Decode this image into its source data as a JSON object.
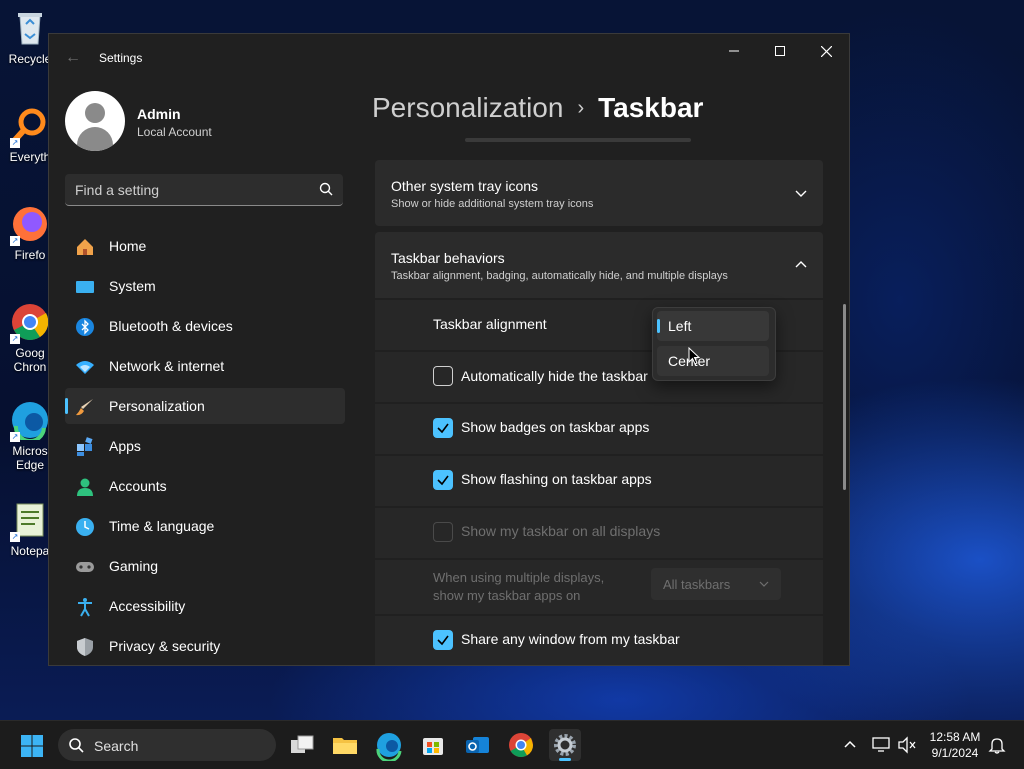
{
  "desktop": {
    "icons": [
      {
        "label": "Recycle",
        "name": "recycle-bin"
      },
      {
        "label": "Everyth",
        "name": "everything"
      },
      {
        "label": "Firefo",
        "name": "firefox"
      },
      {
        "label": "Goog Chron",
        "name": "google-chrome"
      },
      {
        "label": "Micros Edge",
        "name": "microsoft-edge"
      },
      {
        "label": "Notepa",
        "name": "notepad"
      }
    ]
  },
  "window": {
    "app_title": "Settings",
    "controls": {
      "minimize": "—",
      "maximize": "☐",
      "close": "✕"
    },
    "back_glyph": "←"
  },
  "user": {
    "name": "Admin",
    "account_type": "Local Account"
  },
  "search": {
    "placeholder": "Find a setting"
  },
  "nav": [
    {
      "label": "Home",
      "icon": "home-icon"
    },
    {
      "label": "System",
      "icon": "system-icon"
    },
    {
      "label": "Bluetooth & devices",
      "icon": "bluetooth-icon"
    },
    {
      "label": "Network & internet",
      "icon": "network-icon"
    },
    {
      "label": "Personalization",
      "icon": "personalization-icon",
      "active": true
    },
    {
      "label": "Apps",
      "icon": "apps-icon"
    },
    {
      "label": "Accounts",
      "icon": "accounts-icon"
    },
    {
      "label": "Time & language",
      "icon": "time-language-icon"
    },
    {
      "label": "Gaming",
      "icon": "gaming-icon"
    },
    {
      "label": "Accessibility",
      "icon": "accessibility-icon"
    },
    {
      "label": "Privacy & security",
      "icon": "privacy-security-icon"
    }
  ],
  "header": {
    "crumb": "Personalization",
    "separator": "›",
    "current": "Taskbar"
  },
  "sections": {
    "tray_icons": {
      "title": "Other system tray icons",
      "subtitle": "Show or hide additional system tray icons"
    },
    "behaviors": {
      "title": "Taskbar behaviors",
      "subtitle": "Taskbar alignment, badging, automatically hide, and multiple displays"
    }
  },
  "behaviors": {
    "alignment_label": "Taskbar alignment",
    "auto_hide": {
      "label": "Automatically hide the taskbar",
      "checked": false
    },
    "badges": {
      "label": "Show badges on taskbar apps",
      "checked": true
    },
    "flashing": {
      "label": "Show flashing on taskbar apps",
      "checked": true
    },
    "all_displays": {
      "label": "Show my taskbar on all displays",
      "checked": false,
      "disabled": true
    },
    "multi_display": {
      "line1": "When using multiple displays,",
      "line2": "show my taskbar apps on",
      "value": "All taskbars"
    },
    "share_window": {
      "label": "Share any window from my taskbar",
      "checked": true
    }
  },
  "alignment_dropdown": {
    "options": [
      "Left",
      "Center"
    ],
    "selected": "Left"
  },
  "taskbar": {
    "search_placeholder": "Search",
    "time": "12:58 AM",
    "date": "9/1/2024"
  },
  "colors": {
    "accent": "#4cc2ff",
    "window_bg": "#202020",
    "card_bg": "#2b2b2b"
  }
}
